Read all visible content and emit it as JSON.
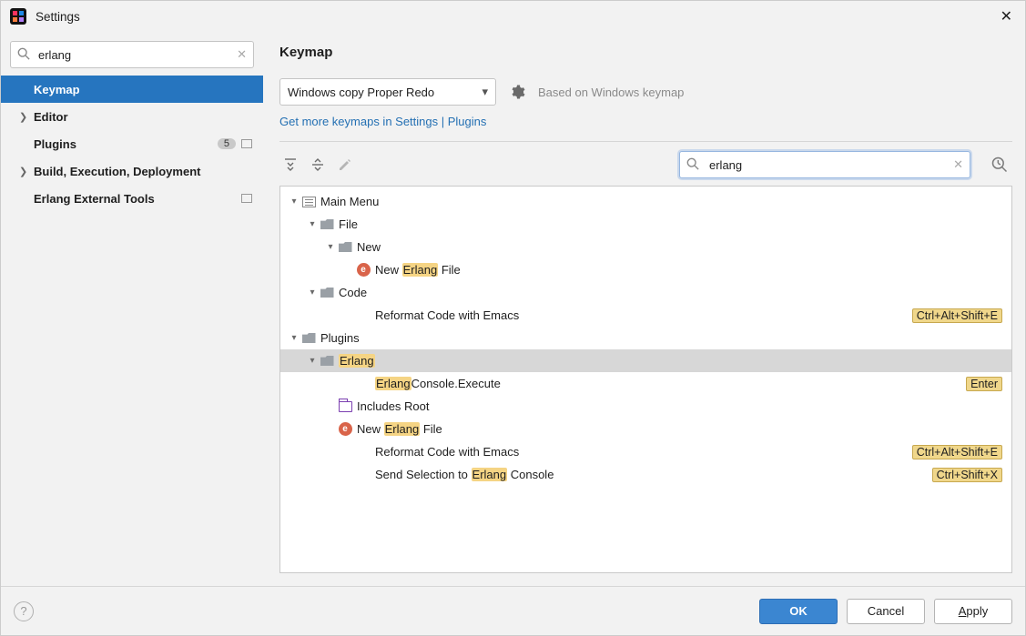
{
  "window": {
    "title": "Settings"
  },
  "sidebar": {
    "search": {
      "value": "erlang",
      "placeholder": ""
    },
    "items": [
      {
        "label": "Keymap",
        "selected": true,
        "expandable": false
      },
      {
        "label": "Editor",
        "expandable": true
      },
      {
        "label": "Plugins",
        "expandable": false,
        "badge": "5",
        "box": true
      },
      {
        "label": "Build, Execution, Deployment",
        "expandable": true
      },
      {
        "label": "Erlang External Tools",
        "expandable": false,
        "box": true
      }
    ]
  },
  "content": {
    "heading": "Keymap",
    "keymap_select": "Windows copy Proper Redo",
    "based_on": "Based on Windows keymap",
    "link_text": "Get more keymaps in Settings | Plugins",
    "action_search": {
      "value": "erlang"
    }
  },
  "tree": [
    {
      "depth": 0,
      "twisty": "down",
      "icon": "menu",
      "text": "Main Menu"
    },
    {
      "depth": 1,
      "twisty": "down",
      "icon": "folder",
      "text": "File"
    },
    {
      "depth": 2,
      "twisty": "down",
      "icon": "folder",
      "text": "New"
    },
    {
      "depth": 3,
      "twisty": "",
      "icon": "e",
      "pre": "New ",
      "hl": "Erlang",
      "post": " File"
    },
    {
      "depth": 1,
      "twisty": "down",
      "icon": "folder",
      "text": "Code"
    },
    {
      "depth": 3,
      "twisty": "",
      "icon": "",
      "text": "Reformat Code with Emacs",
      "shortcut": "Ctrl+Alt+Shift+E"
    },
    {
      "depth": 0,
      "twisty": "down",
      "icon": "folder",
      "text": "Plugins"
    },
    {
      "depth": 1,
      "twisty": "down",
      "icon": "folder",
      "hl": "Erlang",
      "selected": true
    },
    {
      "depth": 3,
      "twisty": "",
      "icon": "",
      "hl": "Erlang",
      "post": "Console.Execute",
      "shortcut": "Enter"
    },
    {
      "depth": 2,
      "twisty": "",
      "icon": "purple-folder",
      "text": "Includes Root"
    },
    {
      "depth": 2,
      "twisty": "",
      "icon": "e",
      "pre": "New ",
      "hl": "Erlang",
      "post": " File"
    },
    {
      "depth": 3,
      "twisty": "",
      "icon": "",
      "text": "Reformat Code with Emacs",
      "shortcut": "Ctrl+Alt+Shift+E"
    },
    {
      "depth": 3,
      "twisty": "",
      "icon": "",
      "pre": "Send Selection to ",
      "hl": "Erlang",
      "post": " Console",
      "shortcut": "Ctrl+Shift+X"
    }
  ],
  "footer": {
    "ok": "OK",
    "cancel": "Cancel",
    "apply": "Apply"
  }
}
